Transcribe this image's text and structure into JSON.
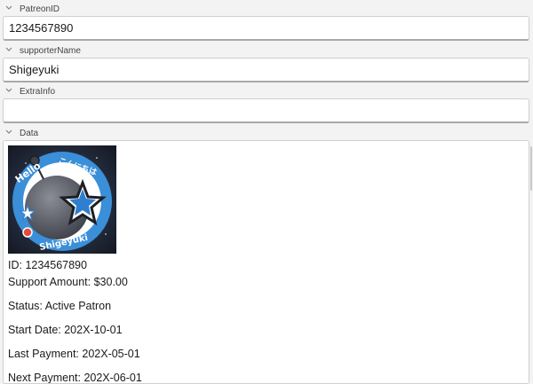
{
  "fields": {
    "patreon_id": {
      "label": "PatreonID",
      "value": "1234567890"
    },
    "supporter_name": {
      "label": "supporterName",
      "value": "Shigeyuki"
    },
    "extra_info": {
      "label": "ExtraInfo",
      "value": ""
    }
  },
  "data_section": {
    "label": "Data",
    "avatar_text": {
      "hello": "Hello",
      "name": "Shigeyuki",
      "jp": "こんにちは"
    },
    "lines": {
      "id": "ID: 1234567890",
      "support_amount": "Support Amount: $30.00",
      "status": "Status: Active Patron",
      "start_date": "Start Date: 202X-10-01",
      "last_payment": "Last Payment: 202X-05-01",
      "next_payment": "Next Payment: 202X-06-01"
    }
  },
  "colors": {
    "background": "#f3f3f3",
    "field_bg": "#ffffff",
    "avatar_blue": "#3a8fd8",
    "avatar_star": "#2f7fd0"
  }
}
